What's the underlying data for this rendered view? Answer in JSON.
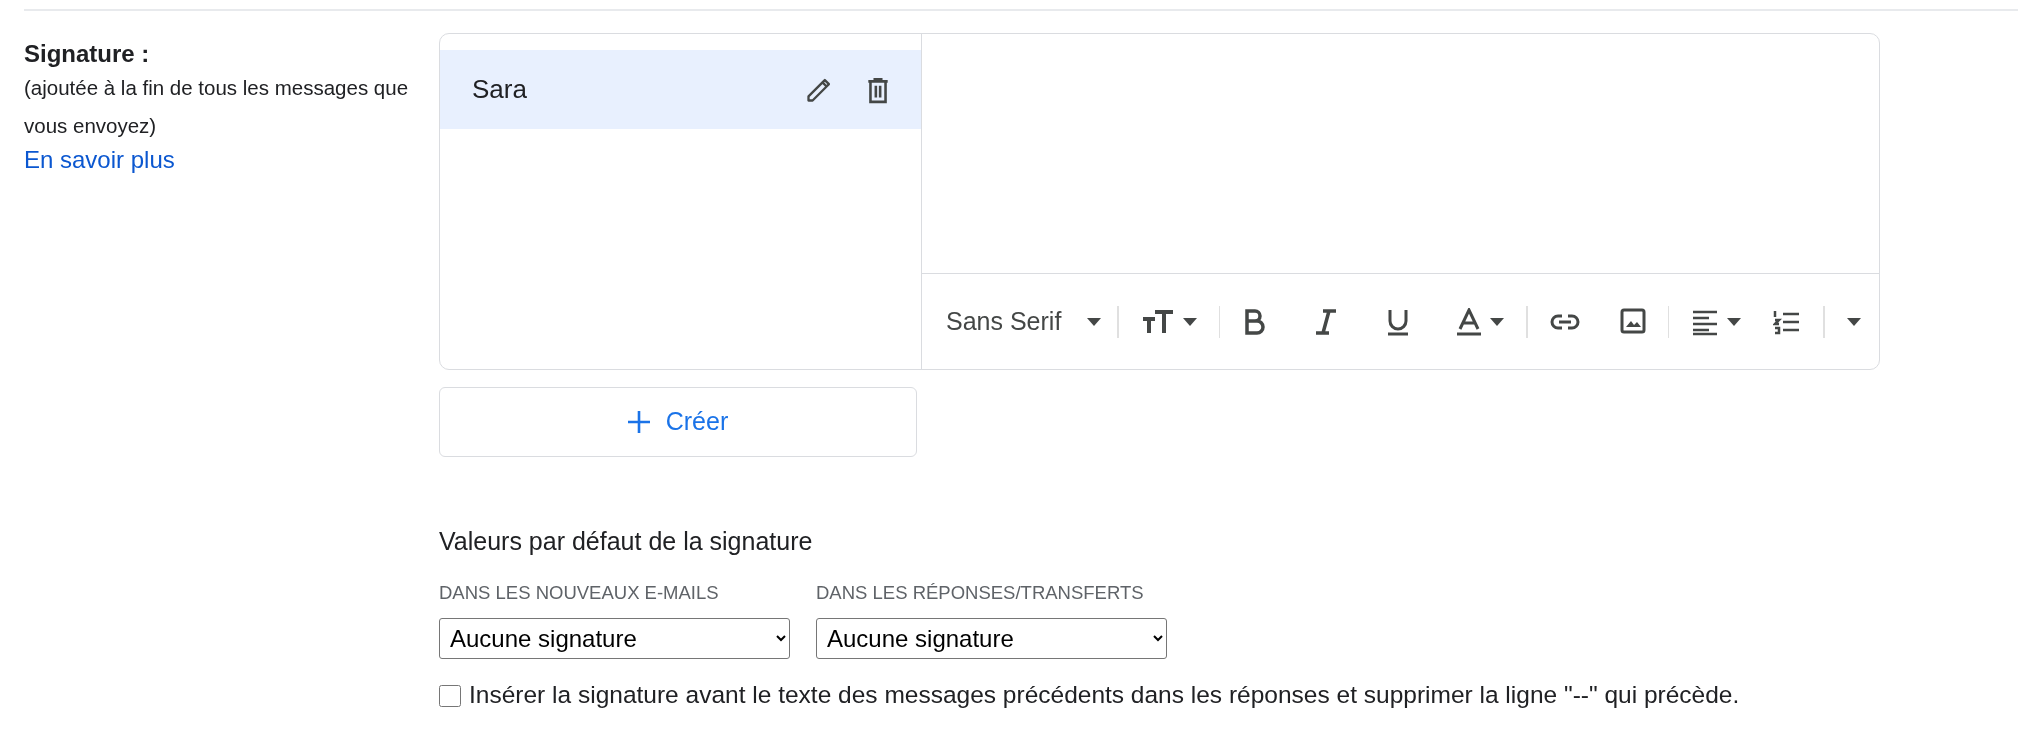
{
  "section": {
    "title": "Signature :",
    "description": "(ajoutée à la fin de tous les messages que vous envoyez)",
    "link": "En savoir plus"
  },
  "signatures": [
    {
      "name": "Sara",
      "selected": true
    }
  ],
  "editor": {
    "font": "Sans Serif"
  },
  "create_button": "Créer",
  "defaults": {
    "title": "Valeurs par défaut de la signature",
    "fields": [
      {
        "label": "DANS LES NOUVEAUX E-MAILS",
        "value": "Aucune signature"
      },
      {
        "label": "DANS LES RÉPONSES/TRANSFERTS",
        "value": "Aucune signature"
      }
    ]
  },
  "insert_before": {
    "label": "Insérer la signature avant le texte des messages précédents dans les réponses et supprimer la ligne \"--\" qui précède.",
    "checked": false
  }
}
